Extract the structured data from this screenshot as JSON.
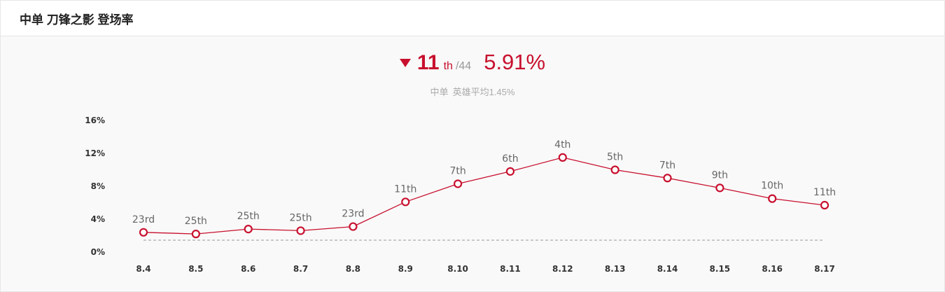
{
  "header": {
    "title": "中单 刀锋之影 登场率"
  },
  "summary": {
    "rank": "11",
    "rank_suffix": "th",
    "rank_total": "/44",
    "rate": "5.91%",
    "avg_role": "中单",
    "avg_text": "英雄平均1.45%"
  },
  "colors": {
    "accent": "#c8102e",
    "avg_line": "#aaaaaa"
  },
  "chart_data": {
    "type": "line",
    "categories": [
      "8.4",
      "8.5",
      "8.6",
      "8.7",
      "8.8",
      "8.9",
      "8.10",
      "8.11",
      "8.12",
      "8.13",
      "8.14",
      "8.15",
      "8.16",
      "8.17"
    ],
    "series": [
      {
        "values": [
          2.4,
          2.2,
          2.8,
          2.6,
          3.1,
          6.1,
          8.3,
          9.8,
          11.5,
          10.0,
          9.0,
          7.8,
          6.5,
          5.7
        ],
        "data_labels": [
          "23rd",
          "25th",
          "25th",
          "25th",
          "23rd",
          "11th",
          "7th",
          "6th",
          "4th",
          "5th",
          "7th",
          "9th",
          "10th",
          "11th"
        ]
      }
    ],
    "average": 1.45,
    "y_ticks": [
      0,
      4,
      8,
      12,
      16
    ],
    "y_tick_labels": [
      "0%",
      "4%",
      "8%",
      "12%",
      "16%"
    ],
    "ylim": [
      0,
      16
    ],
    "grid": false,
    "legend": "none"
  }
}
